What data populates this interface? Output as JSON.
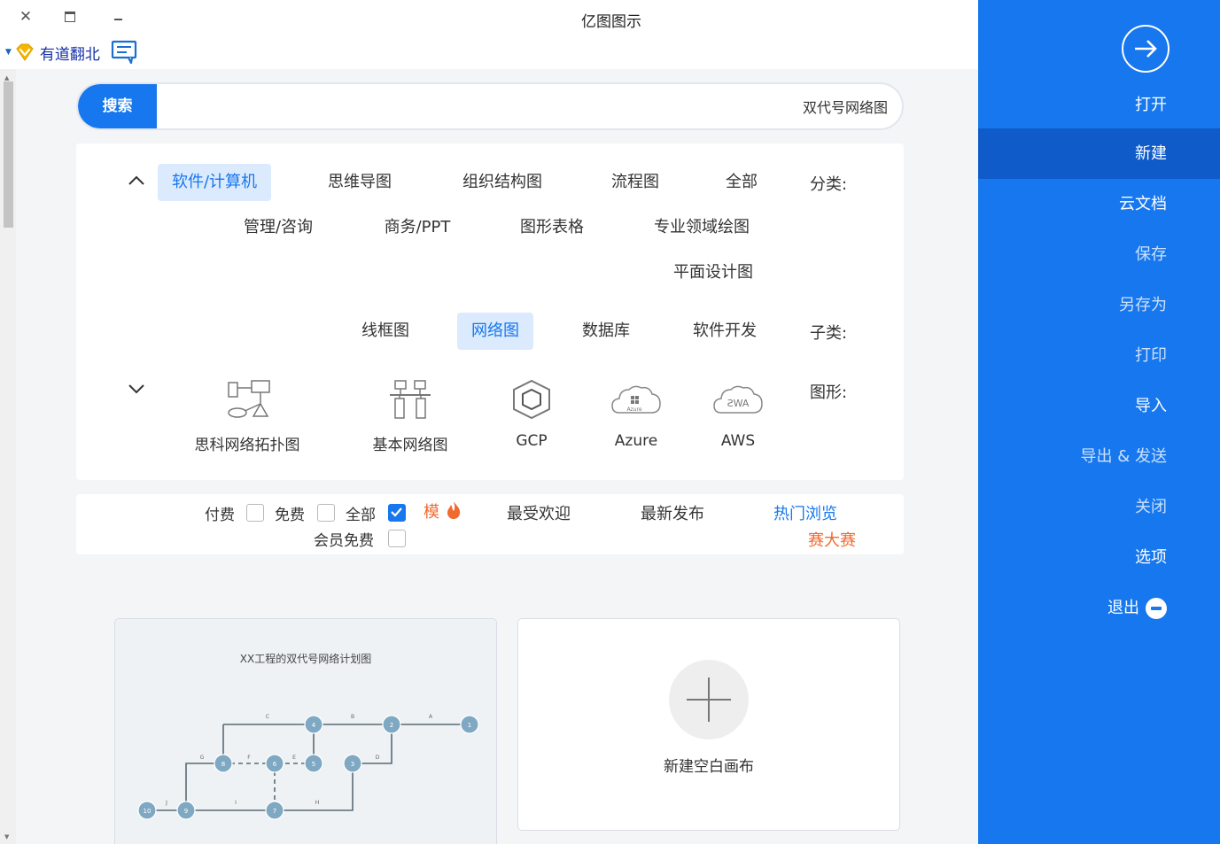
{
  "window": {
    "title": "亿图图示",
    "close_glyph": "✕"
  },
  "youdao": {
    "label": "有道翻北"
  },
  "search": {
    "button_label": "搜索",
    "query": "双代号网络图"
  },
  "filters": {
    "category_label": "分类:",
    "categories": [
      "全部",
      "流程图",
      "组织结构图",
      "思维导图",
      "软件/计算机",
      "专业领域绘图",
      "图形表格",
      "商务/PPT",
      "管理/咨询",
      "平面设计图"
    ],
    "subcategory_label": "子类:",
    "subcategories": [
      "软件开发",
      "数据库",
      "网络图",
      "线框图"
    ],
    "shape_label": "图形:",
    "shapes": [
      "AWS",
      "Azure",
      "GCP",
      "基本网络图",
      "思科网络拓扑图"
    ]
  },
  "sortbar": {
    "hot_browse": "热门浏览",
    "contest": "赛大赛",
    "newest": "最新发布",
    "most_liked": "最受欢迎",
    "hot_badge": "模",
    "all": "全部",
    "free": "免费",
    "paid": "付费",
    "member_free": "会员免费"
  },
  "cards": {
    "template_title": "XX工程的双代号网络计划图",
    "blank_label": "新建空白画布",
    "node_labels": [
      "1",
      "2",
      "3",
      "4",
      "5",
      "6",
      "7",
      "8",
      "9",
      "10"
    ],
    "edge_labels": [
      "A",
      "B",
      "C",
      "D",
      "E",
      "F",
      "G",
      "H",
      "I",
      "J",
      "K",
      "L"
    ]
  },
  "sidebar": {
    "open": "打开",
    "items": [
      "新建",
      "云文档",
      "保存",
      "另存为",
      "打印",
      "导入",
      "导出 & 发送",
      "关闭",
      "选项"
    ],
    "exit": "退出"
  },
  "colors": {
    "accent": "#1677ee",
    "sidebar_active": "#0f5bc9",
    "orange": "#f06a30",
    "node": "#7fa8c2"
  }
}
